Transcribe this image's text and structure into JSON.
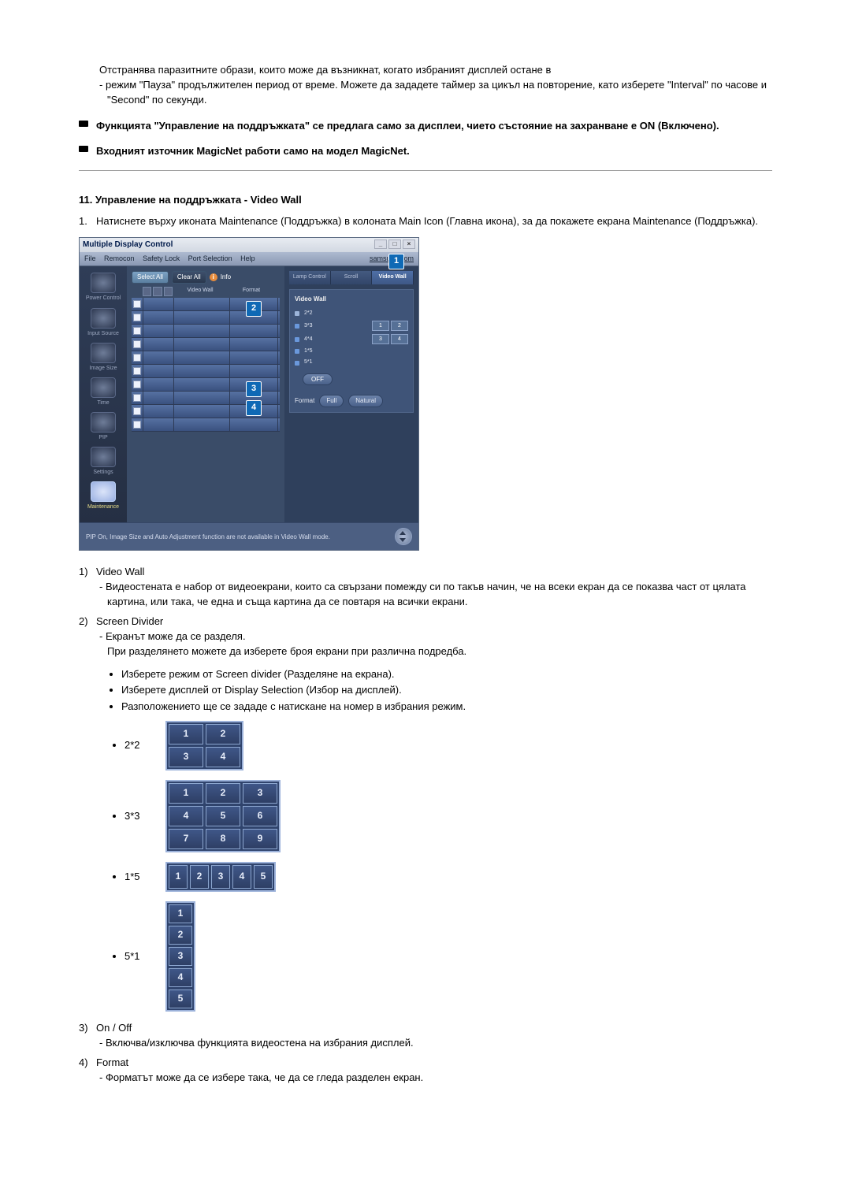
{
  "intro": {
    "p1": "Отстранява паразитните образи, които може да възникнат, когато избраният дисплей остане в",
    "p2": "- режим \"Пауза\" продължителен период от време. Можете да зададете таймер за цикъл на повторение, като изберете \"Interval\" по часове и \"Second\" по секунди."
  },
  "note1": "Функцията \"Управление на поддръжката\" се предлага само за дисплеи, чието състояние на захранване е ON (Включено).",
  "note2": "Входният източник MagicNet работи само на модел MagicNet.",
  "section_title": "11. Управление на поддръжката - Video Wall",
  "step1": "Натиснете върху иконата Maintenance (Поддръжка) в колоната Main Icon (Главна икона), за да покажете екрана Maintenance (Поддръжка).",
  "mdc": {
    "title": "Multiple Display Control",
    "link": "samsung.com",
    "menus": [
      "File",
      "Remocon",
      "Safety Lock",
      "Port Selection",
      "Help"
    ],
    "buttons": {
      "select_all": "Select All",
      "clear_all": "Clear All",
      "info": "Info"
    },
    "cols": {
      "video_wall": "Video Wall",
      "format": "Format"
    },
    "sidebar": [
      "Power Control",
      "Input Source",
      "Image Size",
      "Time",
      "PIP",
      "Settings",
      "Maintenance"
    ],
    "tabs": [
      "Lamp Control",
      "Scroll",
      "Video Wall"
    ],
    "panel": {
      "title": "Video Wall",
      "modes": [
        "2*2",
        "3*3",
        "4*4",
        "1*5",
        "5*1"
      ],
      "off": "OFF",
      "format": "Format",
      "options": [
        "Full",
        "Natural"
      ]
    },
    "footer": "PIP On, Image Size and Auto Adjustment function are not available in Video Wall mode.",
    "annotations": [
      "1",
      "2",
      "3",
      "4"
    ]
  },
  "items": {
    "i1": {
      "num": "1)",
      "title": "Video Wall",
      "d1": "- Видеостената е набор от видеоекрани, които са свързани помежду си по такъв начин, че на всеки екран да се показва част от цялата картина, или така, че една и съща картина да се повтаря на всички екрани."
    },
    "i2": {
      "num": "2)",
      "title": "Screen Divider",
      "d1": "- Екранът може да се разделя.",
      "d2": "При разделянето можете да изберете броя екрани при различна подредба.",
      "b1": "Изберете режим от Screen divider (Разделяне на екрана).",
      "b2": "Изберете дисплей от Display Selection (Избор на дисплей).",
      "b3": "Разположението ще се зададе с натискане на номер в избрания режим."
    },
    "i3": {
      "num": "3)",
      "title": "On / Off",
      "d1": "- Включва/изключва функцията видеостена на избрания дисплей."
    },
    "i4": {
      "num": "4)",
      "title": "Format",
      "d1": "- Форматът може да се избере така, че да се гледа разделен екран."
    }
  },
  "layouts": {
    "l22": {
      "label": "2*2",
      "rows": [
        [
          "1",
          "2"
        ],
        [
          "3",
          "4"
        ]
      ]
    },
    "l33": {
      "label": "3*3",
      "rows": [
        [
          "1",
          "2",
          "3"
        ],
        [
          "4",
          "5",
          "6"
        ],
        [
          "7",
          "8",
          "9"
        ]
      ]
    },
    "l15": {
      "label": "1*5",
      "rows": [
        [
          "1",
          "2",
          "3",
          "4",
          "5"
        ]
      ]
    },
    "l51": {
      "label": "5*1",
      "rows": [
        [
          "1"
        ],
        [
          "2"
        ],
        [
          "3"
        ],
        [
          "4"
        ],
        [
          "5"
        ]
      ]
    }
  }
}
